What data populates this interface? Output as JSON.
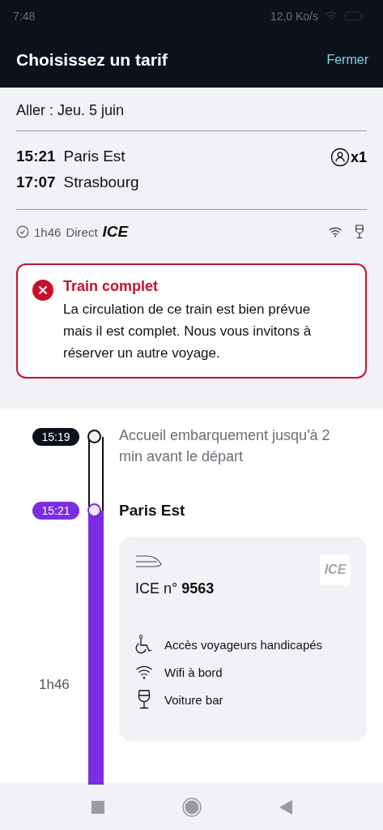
{
  "status_bar": {
    "time": "7:48",
    "network_speed": "12,0 Ko/s"
  },
  "header": {
    "title": "Choisissez un tarif",
    "close": "Fermer"
  },
  "journey": {
    "date": "Aller : Jeu. 5 juin",
    "stops": [
      {
        "time": "15:21",
        "station": "Paris Est"
      },
      {
        "time": "17:07",
        "station": "Strasbourg"
      }
    ],
    "passengers": "x1",
    "duration": "1h46",
    "type": "Direct",
    "brand": "ICE"
  },
  "alert": {
    "title": "Train complet",
    "message": "La circulation de ce train est bien prévue mais il est complet. Nous vous invitons à réserver un autre voyage."
  },
  "timeline": {
    "steps": [
      {
        "kind": "boarding",
        "time": "15:19",
        "text": "Accueil embarquement jusqu'à 2 min avant le départ"
      },
      {
        "kind": "station",
        "time": "15:21",
        "text": "Paris Est"
      }
    ],
    "duration": "1h46",
    "train": {
      "brand": "ICE",
      "name": "ICE n° **9563**",
      "services": [
        {
          "kind": "accessibility",
          "label": "Accès voyageurs handicapés"
        },
        {
          "kind": "wifi",
          "label": "Wifi à bord"
        },
        {
          "kind": "bar",
          "label": "Voiture bar"
        }
      ]
    }
  }
}
